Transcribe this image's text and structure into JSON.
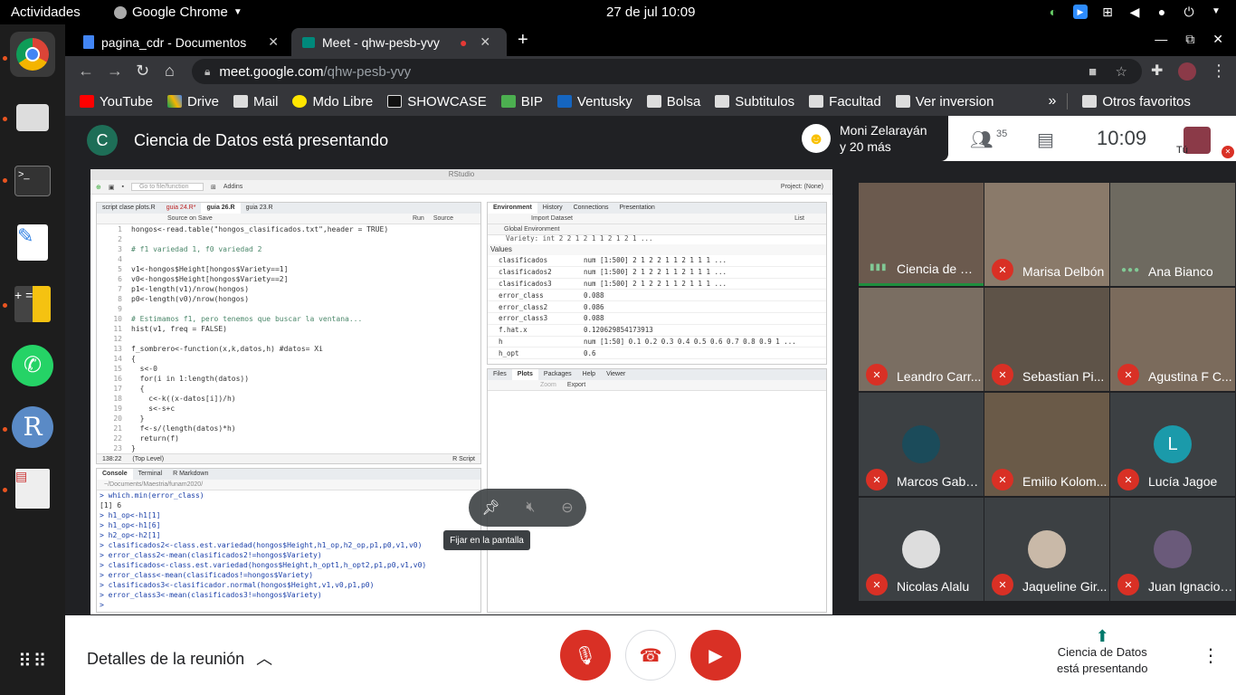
{
  "system": {
    "activities": "Actividades",
    "app": "Google Chrome",
    "clock": "27 de jul  10:09"
  },
  "tabs": [
    {
      "title": "pagina_cdr - Documentos"
    },
    {
      "title": "Meet - qhw-pesb-yvy"
    }
  ],
  "address": {
    "host": "meet.google.com",
    "path": "/qhw-pesb-yvy"
  },
  "bookmarks": [
    "YouTube",
    "Drive",
    "Mail",
    "Mdo Libre",
    "SHOWCASE",
    "BIP",
    "Ventusky",
    "Bolsa",
    "Subtitulos",
    "Facultad",
    "Ver inversion"
  ],
  "bookmarks_more": "»",
  "bookmarks_other": "Otros favoritos",
  "meet": {
    "presenter_initial": "C",
    "presenting_text": "Ciencia de Datos está presentando",
    "presenting_pill": {
      "name": "Moni Zelarayán",
      "more": "y 20 más"
    },
    "participants_count": "35",
    "time": "10:09",
    "self_label": "Tú",
    "pin_tooltip": "Fijar en la pantalla",
    "details": "Detalles de la reunión",
    "present_line1": "Ciencia de Datos",
    "present_line2": "está presentando"
  },
  "participants": [
    {
      "name": "Ciencia de Da...",
      "muted": false
    },
    {
      "name": "Marisa Delbón",
      "muted": true
    },
    {
      "name": "Ana Bianco",
      "muted": false
    },
    {
      "name": "Leandro Carr...",
      "muted": true
    },
    {
      "name": "Sebastian Pi...",
      "muted": true
    },
    {
      "name": "Agustina F C...",
      "muted": true
    },
    {
      "name": "Marcos Gabri...",
      "muted": true
    },
    {
      "name": "Emilio Kolom...",
      "muted": true
    },
    {
      "name": "Lucía Jagoe",
      "muted": true,
      "initial": "L"
    },
    {
      "name": "Nicolas Alalu",
      "muted": true
    },
    {
      "name": "Jaqueline Gir...",
      "muted": true
    },
    {
      "name": "Juan Ignacio ...",
      "muted": true
    }
  ],
  "rstudio": {
    "title": "RStudio",
    "goto": "Go to file/function",
    "addins": "Addins",
    "project": "Project: (None)",
    "editor_tabs": [
      "script clase plots.R",
      "guia 24.R*",
      "guia 26.R",
      "guia 23.R"
    ],
    "source_on_save": "Source on Save",
    "run": "Run",
    "source": "Source",
    "status_pos": "138:22",
    "status_level": "(Top Level)",
    "status_type": "R Script",
    "code": [
      "hongos<-read.table(\"hongos_clasificados.txt\",header = TRUE)",
      "",
      "# f1 variedad 1, f0 variedad 2",
      "",
      "v1<-hongos$Height[hongos$Variety==1]",
      "v0<-hongos$Height[hongos$Variety==2]",
      "p1<-length(v1)/nrow(hongos)",
      "p0<-length(v0)/nrow(hongos)",
      "",
      "# Estimamos f1, pero tenemos que buscar la ventana...",
      "hist(v1, freq = FALSE)",
      "",
      "f_sombrero<-function(x,k,datos,h) #datos= Xi",
      "{",
      "  s<-0",
      "  for(i in 1:length(datos))",
      "  {",
      "    c<-k((x-datos[i])/h)",
      "    s<-s+c",
      "  }",
      "  f<-s/(length(datos)*h)",
      "  return(f)",
      "}"
    ],
    "env_tabs": [
      "Environment",
      "History",
      "Connections",
      "Presentation"
    ],
    "import_dataset": "Import Dataset",
    "list_label": "List",
    "global_env": "Global Environment",
    "env_partial": "Variety: int 2 2 1 2 1 1 2 1 2 1 ...",
    "values_label": "Values",
    "env": [
      {
        "name": "clasificados",
        "value": "num [1:500] 2 1 2 2 1 1 2 1 1 1 ..."
      },
      {
        "name": "clasificados2",
        "value": "num [1:500] 2 1 2 2 1 1 2 1 1 1 ..."
      },
      {
        "name": "clasificados3",
        "value": "num [1:500] 2 1 2 2 1 1 2 1 1 1 ..."
      },
      {
        "name": "error_class",
        "value": "0.088"
      },
      {
        "name": "error_class2",
        "value": "0.086"
      },
      {
        "name": "error_class3",
        "value": "0.088"
      },
      {
        "name": "f.hat.x",
        "value": "0.120629854173913"
      },
      {
        "name": "h",
        "value": "num [1:50] 0.1 0.2 0.3 0.4 0.5 0.6 0.7 0.8 0.9 1 ..."
      },
      {
        "name": "h_opt",
        "value": "0.6"
      }
    ],
    "files_tabs": [
      "Files",
      "Plots",
      "Packages",
      "Help",
      "Viewer"
    ],
    "zoom": "Zoom",
    "export": "Export",
    "console_tabs": [
      "Console",
      "Terminal",
      "R Markdown"
    ],
    "console_path": "~/Documents/Maestria/funam2020/",
    "console": [
      "> which.min(error_class)",
      "[1] 6",
      "> h1_op<-h1[1]",
      "> h1_op<-h1[6]",
      "> h2_op<-h2[1]",
      "> clasificados2<-class.est.variedad(hongos$Height,h1_op,h2_op,p1,p0,v1,v0)",
      "> error_class2<-mean(clasificados2!=hongos$Variety)",
      "> clasificados<-class.est.variedad(hongos$Height,h_opt1,h_opt2,p1,p0,v1,v0)",
      "> error_class<-mean(clasificados!=hongos$Variety)",
      "> clasificados3<-clasificador.normal(hongos$Height,v1,v0,p1,p0)",
      "> error_class3<-mean(clasificados3!=hongos$Variety)",
      ">"
    ]
  }
}
